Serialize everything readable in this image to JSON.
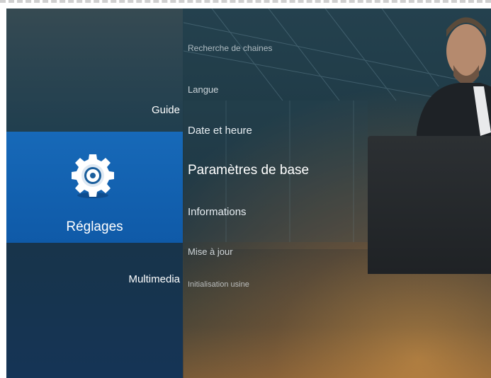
{
  "sidebar": {
    "items": [
      {
        "label": "Guide"
      },
      {
        "label": "Réglages",
        "icon": "gear-icon",
        "selected": true
      },
      {
        "label": "Multimedia"
      }
    ]
  },
  "menu": {
    "items": [
      {
        "label": "Recherche de chaines"
      },
      {
        "label": "Langue"
      },
      {
        "label": "Date et heure"
      },
      {
        "label": "Paramètres de base",
        "focused": true
      },
      {
        "label": "Informations"
      },
      {
        "label": "Mise à jour"
      },
      {
        "label": "Initialisation usine"
      }
    ]
  },
  "colors": {
    "accent": "#1466b4",
    "background": "#1f3a46"
  }
}
